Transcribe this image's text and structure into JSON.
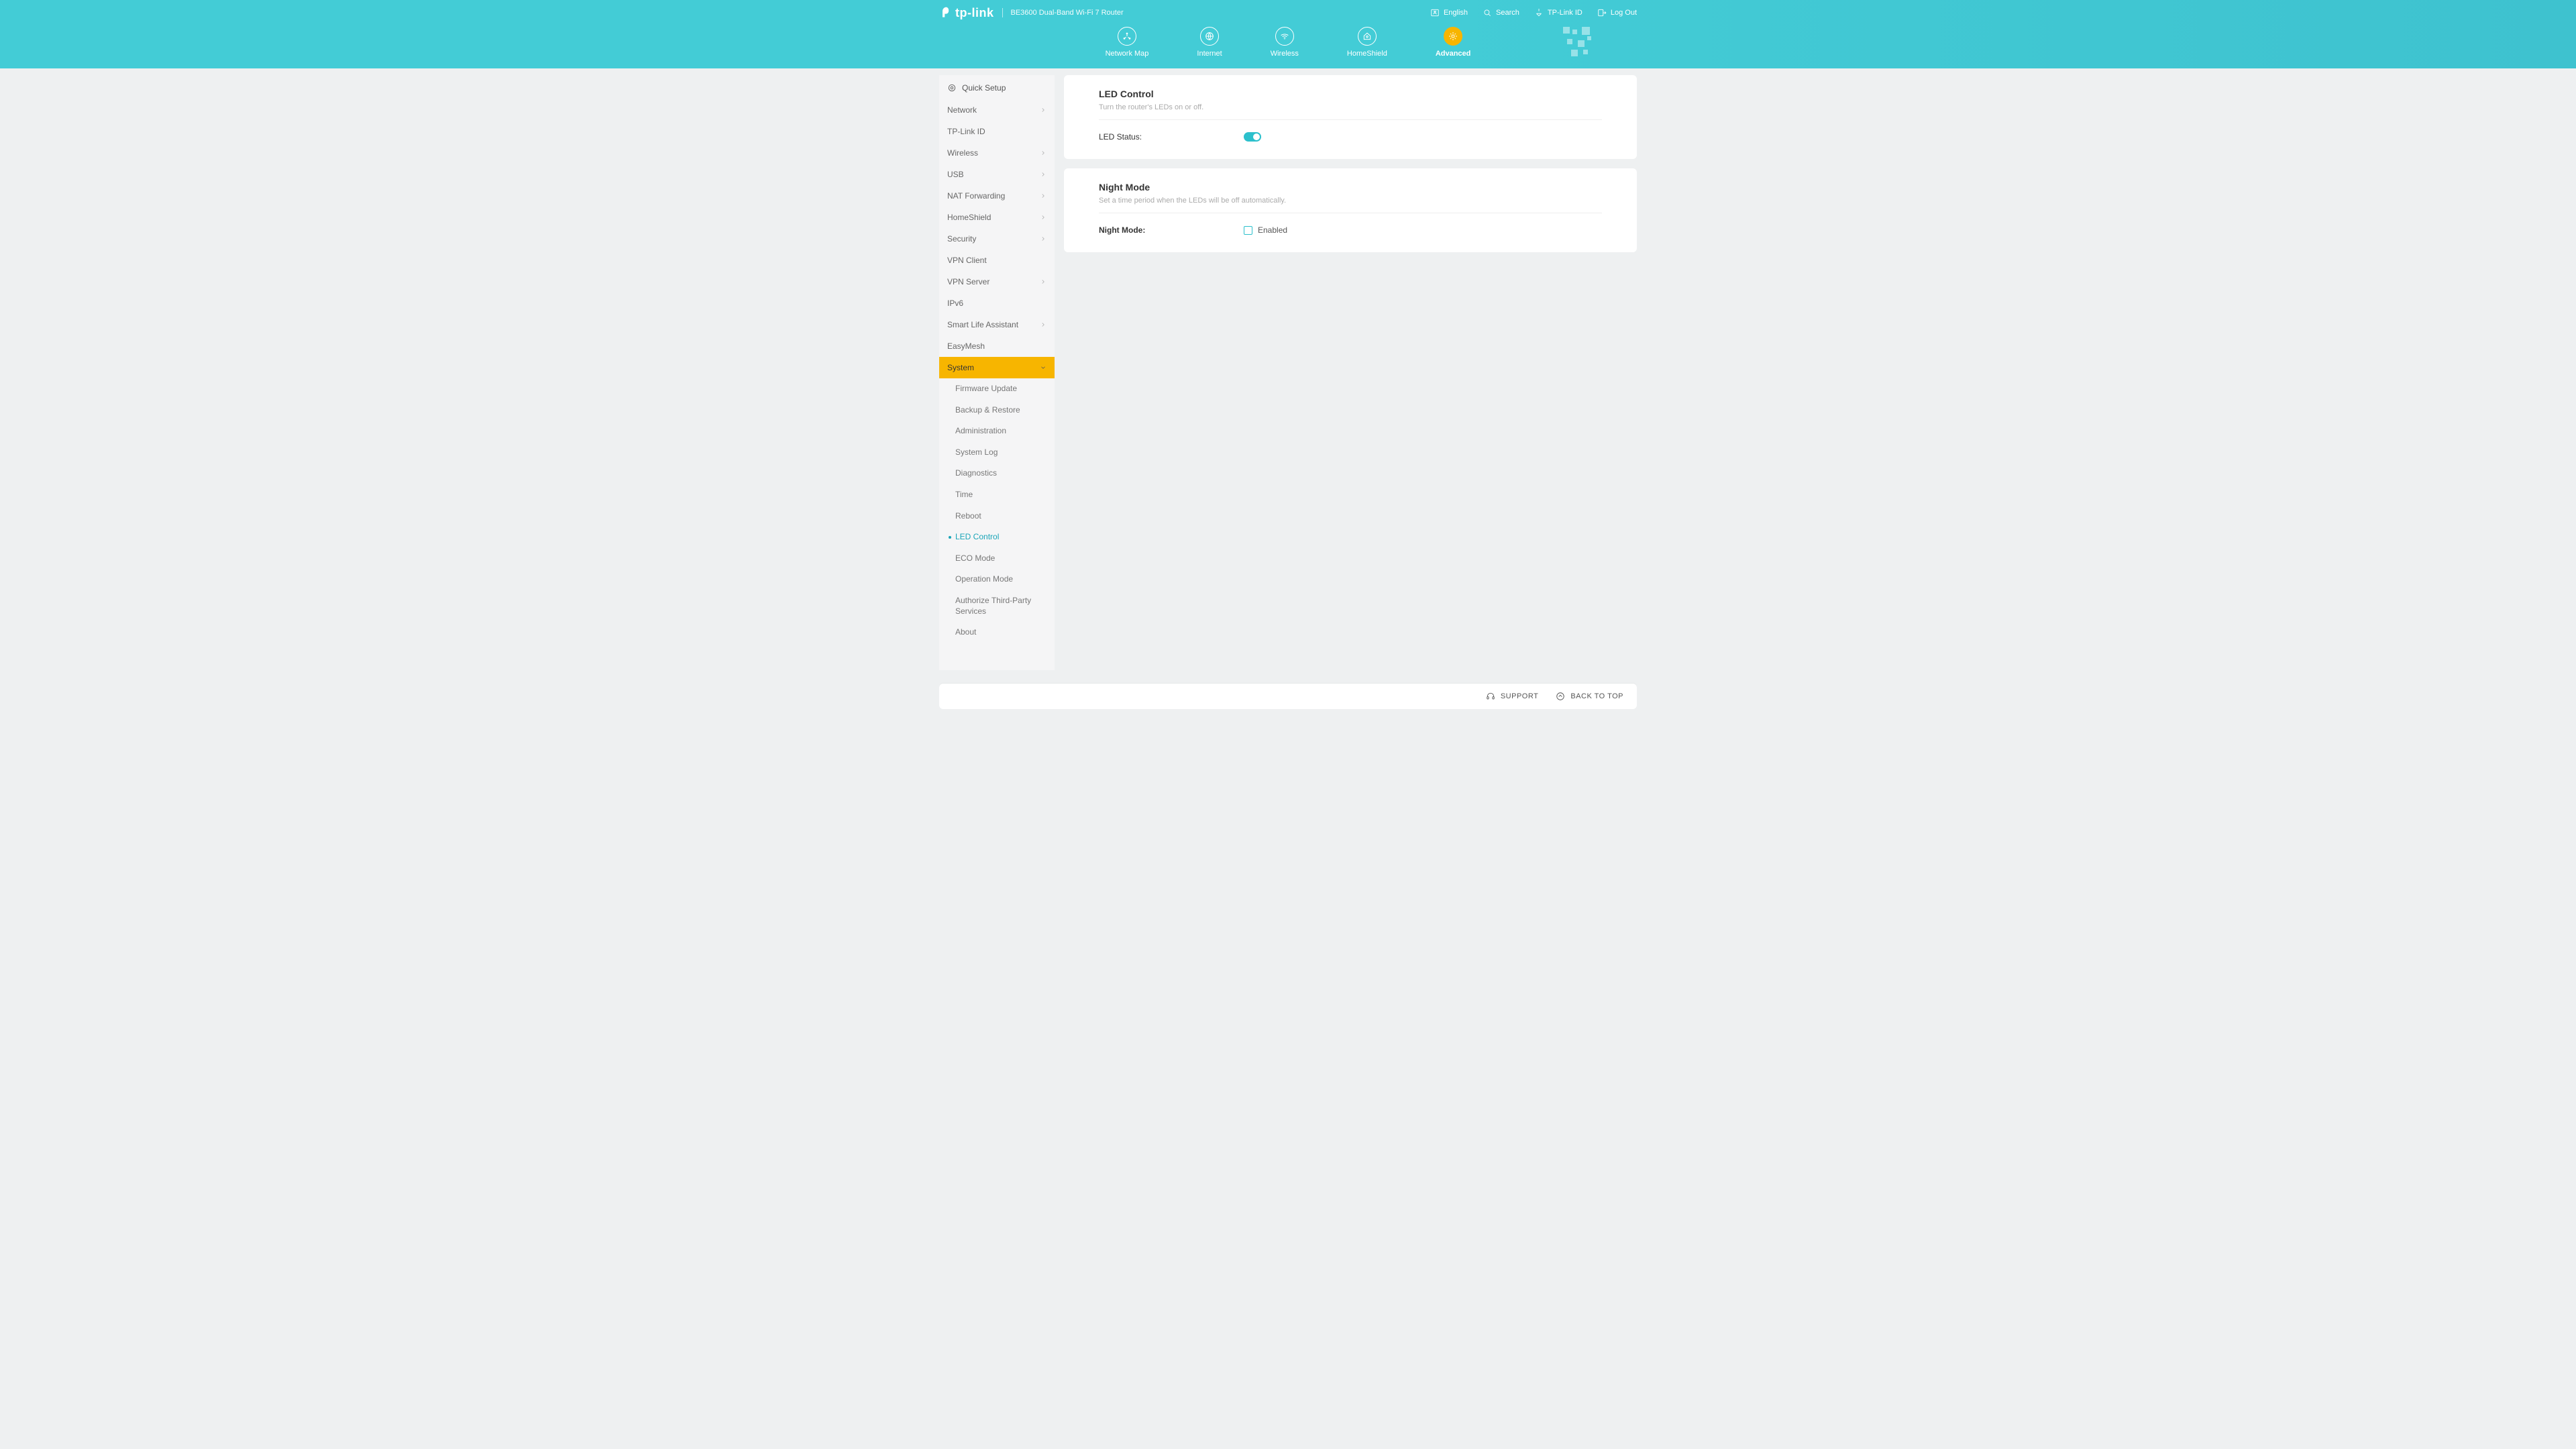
{
  "brand": {
    "name": "tp-link",
    "product": "BE3600 Dual-Band Wi-Fi 7 Router"
  },
  "header_actions": {
    "language": "English",
    "search": "Search",
    "tplink_id": "TP-Link ID",
    "logout": "Log Out"
  },
  "nav": {
    "network_map": "Network Map",
    "internet": "Internet",
    "wireless": "Wireless",
    "homeshield": "HomeShield",
    "advanced": "Advanced"
  },
  "sidebar": {
    "quick_setup": "Quick Setup",
    "items": [
      {
        "label": "Network",
        "expandable": true
      },
      {
        "label": "TP-Link ID",
        "expandable": false
      },
      {
        "label": "Wireless",
        "expandable": true
      },
      {
        "label": "USB",
        "expandable": true
      },
      {
        "label": "NAT Forwarding",
        "expandable": true
      },
      {
        "label": "HomeShield",
        "expandable": true
      },
      {
        "label": "Security",
        "expandable": true
      },
      {
        "label": "VPN Client",
        "expandable": false
      },
      {
        "label": "VPN Server",
        "expandable": true
      },
      {
        "label": "IPv6",
        "expandable": false
      },
      {
        "label": "Smart Life Assistant",
        "expandable": true
      },
      {
        "label": "EasyMesh",
        "expandable": false
      },
      {
        "label": "System",
        "expandable": true,
        "active": true
      }
    ],
    "system_subitems": [
      "Firmware Update",
      "Backup & Restore",
      "Administration",
      "System Log",
      "Diagnostics",
      "Time",
      "Reboot",
      "LED Control",
      "ECO Mode",
      "Operation Mode",
      "Authorize Third-Party Services",
      "About"
    ],
    "system_current": "LED Control"
  },
  "led_card": {
    "title": "LED Control",
    "desc": "Turn the router's LEDs on or off.",
    "status_label": "LED Status:",
    "status_on": true
  },
  "night_card": {
    "title": "Night Mode",
    "desc": "Set a time period when the LEDs will be off automatically.",
    "mode_label": "Night Mode:",
    "enabled_label": "Enabled",
    "enabled": false
  },
  "footer": {
    "support": "SUPPORT",
    "back_to_top": "BACK TO TOP"
  }
}
